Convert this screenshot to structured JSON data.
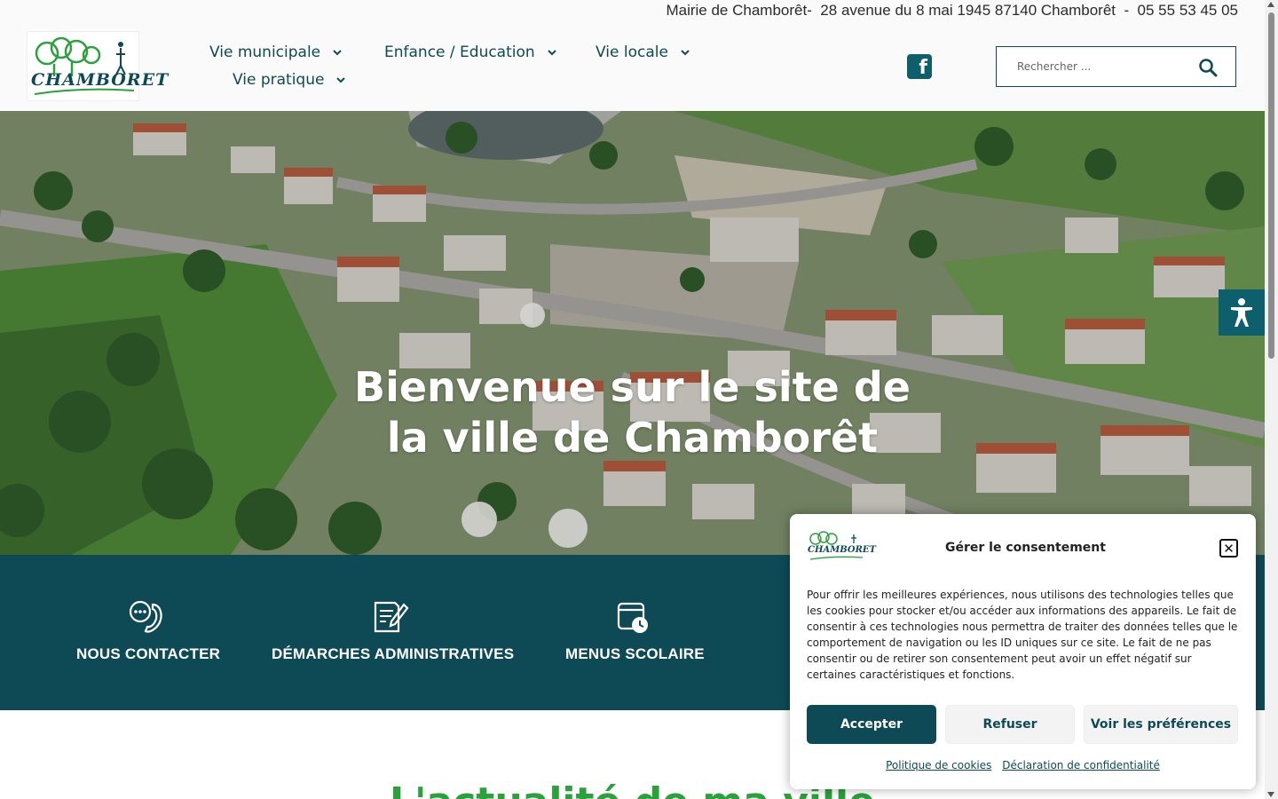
{
  "header": {
    "address": "Mairie de Chamborêt-  28 avenue du 8 mai 1945 87140 Chamborêt  -  05 55 53 45 05",
    "logo_text": "CHAMBORET",
    "nav": [
      {
        "label": "Vie municipale"
      },
      {
        "label": "Enfance / Education"
      },
      {
        "label": "Vie locale"
      },
      {
        "label": "Vie pratique"
      }
    ],
    "social_icon": "facebook-icon",
    "search": {
      "placeholder": "Rechercher ...",
      "icon": "search-icon"
    }
  },
  "hero": {
    "title": "Bienvenue sur le site de la ville de Chamborêt",
    "accessibility_icon": "accessibility-icon"
  },
  "quick_links": [
    {
      "label": "NOUS CONTACTER",
      "icon": "phone-chat-icon"
    },
    {
      "label": "DÉMARCHES ADMINISTRATIVES",
      "icon": "document-pen-icon"
    },
    {
      "label": "MENUS SCOLAIRE",
      "icon": "calendar-clock-icon"
    }
  ],
  "section": {
    "title": "L'actualité de ma ville"
  },
  "consent": {
    "logo_text": "CHAMBORET",
    "title": "Gérer le consentement",
    "close_icon": "close-icon",
    "text": "Pour offrir les meilleures expériences, nous utilisons des technologies telles que les cookies pour stocker et/ou accéder aux informations des appareils. Le fait de consentir à ces technologies nous permettra de traiter des données telles que le comportement de navigation ou les ID uniques sur ce site. Le fait de ne pas consentir ou de retirer son consentement peut avoir un effet négatif sur certaines caractéristiques et fonctions.",
    "accept_label": "Accepter",
    "refuse_label": "Refuser",
    "prefs_label": "Voir les préférences",
    "cookie_policy_label": "Politique de cookies",
    "privacy_label": "Déclaration de confidentialité"
  },
  "colors": {
    "primary": "#0d4a56",
    "accent_green": "#2aa13b",
    "facebook": "#0d5f6b"
  }
}
